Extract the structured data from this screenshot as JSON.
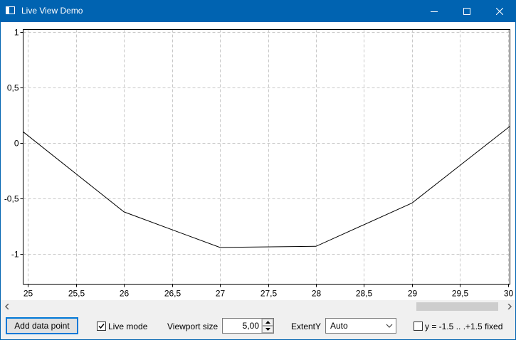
{
  "window": {
    "title": "Live View Demo",
    "icon": "app-window-icon"
  },
  "controls": {
    "add_button": "Add data point",
    "live_mode_label": "Live mode",
    "live_mode_checked": true,
    "viewport_label": "Viewport size",
    "viewport_value": "5,00",
    "extent_label": "ExtentY",
    "extent_value": "Auto",
    "fixed_label": "y = -1.5 .. .+1.5 fixed",
    "fixed_checked": false
  },
  "chart_data": {
    "type": "line",
    "xlim": [
      24.95,
      30.02
    ],
    "ylim": [
      -1.27,
      1.02
    ],
    "x_ticks": [
      "25",
      "25,5",
      "26",
      "26,5",
      "27",
      "27,5",
      "28",
      "28,5",
      "29",
      "29,5",
      "30"
    ],
    "x_tick_values": [
      25,
      25.5,
      26,
      26.5,
      27,
      27.5,
      28,
      28.5,
      29,
      29.5,
      30
    ],
    "y_ticks": [
      "1",
      "0,5",
      "0",
      "-0,5",
      "-1"
    ],
    "y_tick_values": [
      1,
      0.5,
      0,
      -0.5,
      -1
    ],
    "grid": true,
    "series": [
      {
        "x": [
          24.95,
          26,
          27,
          28,
          29,
          30.02
        ],
        "y": [
          0.1,
          -0.62,
          -0.94,
          -0.93,
          -0.54,
          0.15
        ],
        "color": "#000000"
      }
    ]
  }
}
